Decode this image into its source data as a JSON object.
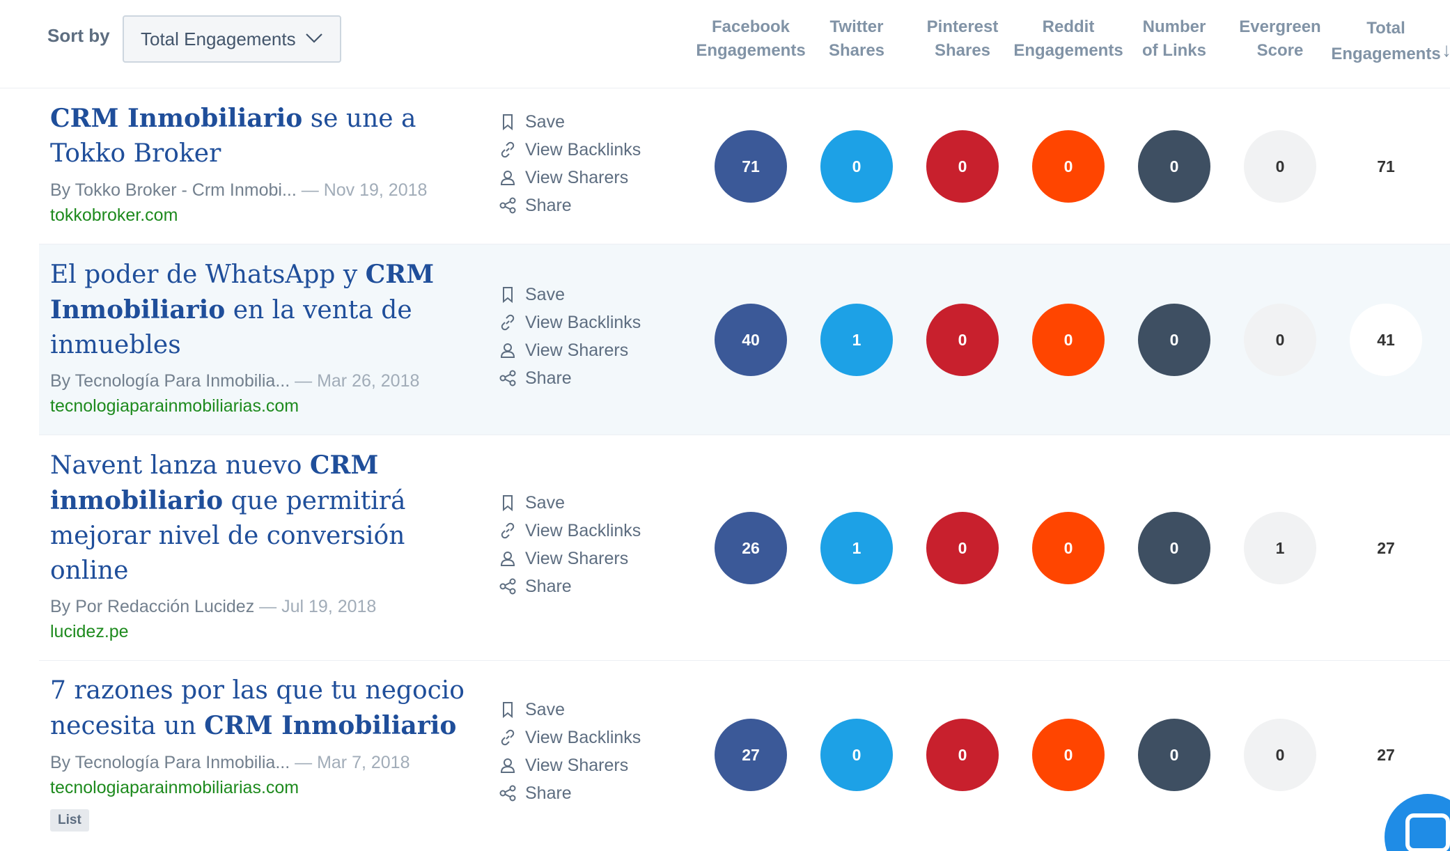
{
  "sort": {
    "label": "Sort by",
    "selected": "Total Engagements"
  },
  "columns": [
    {
      "line1": "Facebook",
      "line2": "Engagements"
    },
    {
      "line1": "Twitter",
      "line2": "Shares"
    },
    {
      "line1": "Pinterest",
      "line2": "Shares"
    },
    {
      "line1": "Reddit",
      "line2": "Engagements"
    },
    {
      "line1": "Number",
      "line2": "of Links"
    },
    {
      "line1": "Evergreen",
      "line2": "Score"
    },
    {
      "line1": "Total",
      "line2": "Engagements"
    }
  ],
  "sort_indicator": "↓",
  "actions": {
    "save": "Save",
    "backlinks": "View Backlinks",
    "sharers": "View Sharers",
    "share": "Share"
  },
  "colors": {
    "facebook": "#3b5998",
    "twitter": "#1da1e6",
    "pinterest": "#c8202d",
    "reddit": "#ff4500",
    "links": "#3e4f62",
    "evergreen": "#f1f2f3",
    "title_link": "#1f4e9a",
    "domain": "#1d8a1d"
  },
  "articles": [
    {
      "title_parts": [
        {
          "text": "CRM Inmobiliario",
          "bold": true
        },
        {
          "text": " se une a Tokko Broker",
          "bold": false
        }
      ],
      "author": "By Tokko Broker - Crm Inmobi...",
      "date": " — Nov 19, 2018",
      "domain": "tokkobroker.com",
      "stats": {
        "facebook": "71",
        "twitter": "0",
        "pinterest": "0",
        "reddit": "0",
        "links": "0",
        "evergreen": "0",
        "total": "71"
      }
    },
    {
      "title_parts": [
        {
          "text": "El poder de WhatsApp y ",
          "bold": false
        },
        {
          "text": "CRM Inmobiliario",
          "bold": true
        },
        {
          "text": " en la venta de inmuebles",
          "bold": false
        }
      ],
      "author": "By Tecnología Para Inmobilia...",
      "date": " — Mar 26, 2018",
      "domain": "tecnologiaparainmobiliarias.com",
      "stats": {
        "facebook": "40",
        "twitter": "1",
        "pinterest": "0",
        "reddit": "0",
        "links": "0",
        "evergreen": "0",
        "total": "41"
      }
    },
    {
      "title_parts": [
        {
          "text": "Navent lanza nuevo ",
          "bold": false
        },
        {
          "text": "CRM inmobiliario",
          "bold": true
        },
        {
          "text": " que permitirá mejorar nivel de conversión online",
          "bold": false
        }
      ],
      "author": "By Por Redacción Lucidez",
      "date": " — Jul 19, 2018",
      "domain": "lucidez.pe",
      "stats": {
        "facebook": "26",
        "twitter": "1",
        "pinterest": "0",
        "reddit": "0",
        "links": "0",
        "evergreen": "1",
        "total": "27"
      }
    },
    {
      "title_parts": [
        {
          "text": "7 razones por las que tu negocio necesita un ",
          "bold": false
        },
        {
          "text": "CRM Inmobiliario",
          "bold": true
        }
      ],
      "author": "By Tecnología Para Inmobilia...",
      "date": " — Mar 7, 2018",
      "domain": "tecnologiaparainmobiliarias.com",
      "tag": "List",
      "stats": {
        "facebook": "27",
        "twitter": "0",
        "pinterest": "0",
        "reddit": "0",
        "links": "0",
        "evergreen": "0",
        "total": "27"
      }
    }
  ]
}
